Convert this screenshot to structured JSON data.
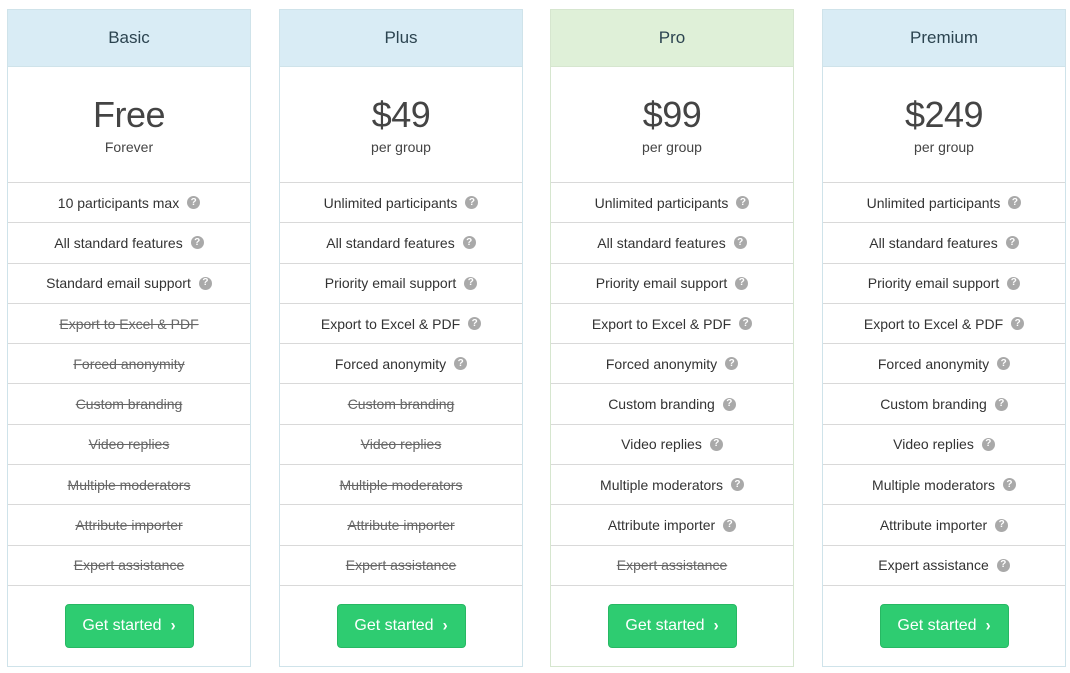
{
  "plans": [
    {
      "name": "Basic",
      "price": "Free",
      "price_sub": "Forever",
      "cta": "Get started",
      "features": [
        {
          "label": "10 participants max",
          "included": true
        },
        {
          "label": "All standard features",
          "included": true
        },
        {
          "label": "Standard email support",
          "included": true
        },
        {
          "label": "Export to Excel & PDF",
          "included": false
        },
        {
          "label": "Forced anonymity",
          "included": false
        },
        {
          "label": "Custom branding",
          "included": false
        },
        {
          "label": "Video replies",
          "included": false
        },
        {
          "label": "Multiple moderators",
          "included": false
        },
        {
          "label": "Attribute importer",
          "included": false
        },
        {
          "label": "Expert assistance",
          "included": false
        }
      ]
    },
    {
      "name": "Plus",
      "price": "$49",
      "price_sub": "per group",
      "cta": "Get started",
      "features": [
        {
          "label": "Unlimited participants",
          "included": true
        },
        {
          "label": "All standard features",
          "included": true
        },
        {
          "label": "Priority email support",
          "included": true
        },
        {
          "label": "Export to Excel & PDF",
          "included": true
        },
        {
          "label": "Forced anonymity",
          "included": true
        },
        {
          "label": "Custom branding",
          "included": false
        },
        {
          "label": "Video replies",
          "included": false
        },
        {
          "label": "Multiple moderators",
          "included": false
        },
        {
          "label": "Attribute importer",
          "included": false
        },
        {
          "label": "Expert assistance",
          "included": false
        }
      ]
    },
    {
      "name": "Pro",
      "price": "$99",
      "price_sub": "per group",
      "cta": "Get started",
      "highlight": true,
      "features": [
        {
          "label": "Unlimited participants",
          "included": true
        },
        {
          "label": "All standard features",
          "included": true
        },
        {
          "label": "Priority email support",
          "included": true
        },
        {
          "label": "Export to Excel & PDF",
          "included": true
        },
        {
          "label": "Forced anonymity",
          "included": true
        },
        {
          "label": "Custom branding",
          "included": true
        },
        {
          "label": "Video replies",
          "included": true
        },
        {
          "label": "Multiple moderators",
          "included": true
        },
        {
          "label": "Attribute importer",
          "included": true
        },
        {
          "label": "Expert assistance",
          "included": false
        }
      ]
    },
    {
      "name": "Premium",
      "price": "$249",
      "price_sub": "per group",
      "cta": "Get started",
      "features": [
        {
          "label": "Unlimited participants",
          "included": true
        },
        {
          "label": "All standard features",
          "included": true
        },
        {
          "label": "Priority email support",
          "included": true
        },
        {
          "label": "Export to Excel & PDF",
          "included": true
        },
        {
          "label": "Forced anonymity",
          "included": true
        },
        {
          "label": "Custom branding",
          "included": true
        },
        {
          "label": "Video replies",
          "included": true
        },
        {
          "label": "Multiple moderators",
          "included": true
        },
        {
          "label": "Attribute importer",
          "included": true
        },
        {
          "label": "Expert assistance",
          "included": true
        }
      ]
    }
  ],
  "icons": {
    "help": "question-circle-icon",
    "cta_arrow": "chevron-right-icon"
  },
  "colors": {
    "header_blue": "#d9ecf5",
    "header_green": "#dff0d8",
    "cta_green": "#2ecc71"
  }
}
